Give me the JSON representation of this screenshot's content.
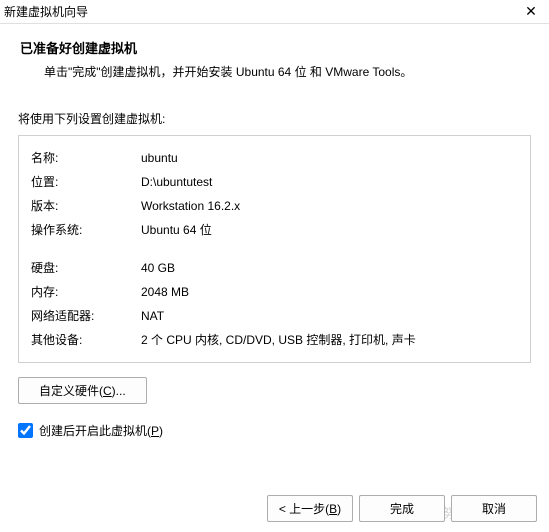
{
  "titlebar": {
    "title": "新建虚拟机向导"
  },
  "header": {
    "title": "已准备好创建虚拟机",
    "description": "单击\"完成\"创建虚拟机，并开始安装 Ubuntu 64 位 和 VMware Tools。"
  },
  "summary_label": "将使用下列设置创建虚拟机:",
  "settings": {
    "group1": [
      {
        "label": "名称:",
        "value": "ubuntu"
      },
      {
        "label": "位置:",
        "value": "D:\\ubuntutest"
      },
      {
        "label": "版本:",
        "value": "Workstation 16.2.x"
      },
      {
        "label": "操作系统:",
        "value": "Ubuntu 64 位"
      }
    ],
    "group2": [
      {
        "label": "硬盘:",
        "value": "40 GB"
      },
      {
        "label": "内存:",
        "value": "2048 MB"
      },
      {
        "label": "网络适配器:",
        "value": "NAT"
      },
      {
        "label": "其他设备:",
        "value": "2 个 CPU 内核, CD/DVD, USB 控制器, 打印机, 声卡"
      }
    ]
  },
  "customize_button_pre": "自定义硬件(",
  "customize_button_u": "C",
  "customize_button_post": ")...",
  "checkbox": {
    "pre": "创建后开启此虚拟机(",
    "u": "P",
    "post": ")",
    "checked": true
  },
  "buttons": {
    "back_pre": "< 上一步(",
    "back_u": "B",
    "back_post": ")",
    "finish": "完成",
    "cancel": "取消"
  },
  "watermark": "CSDN @努力小杨"
}
